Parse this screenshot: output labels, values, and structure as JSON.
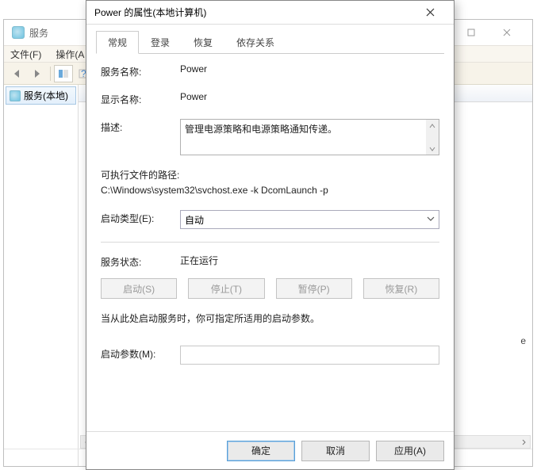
{
  "bgwin": {
    "title": "服务",
    "menu": {
      "file": "文件(F)",
      "action": "操作(A"
    },
    "tree_item": "服务(本地)",
    "extra_letter": "e"
  },
  "dialog": {
    "title": "Power 的属性(本地计算机)",
    "tabs": {
      "general": "常规",
      "logon": "登录",
      "recovery": "恢复",
      "deps": "依存关系"
    },
    "labels": {
      "service_name": "服务名称:",
      "display_name": "显示名称:",
      "description": "描述:",
      "exe_path": "可执行文件的路径:",
      "startup_type": "启动类型(E):",
      "service_state": "服务状态:",
      "start_params_hint": "当从此处启动服务时，你可指定所适用的启动参数。",
      "start_params": "启动参数(M):"
    },
    "values": {
      "service_name": "Power",
      "display_name": "Power",
      "description": "管理电源策略和电源策略通知传递。",
      "exe_path": "C:\\Windows\\system32\\svchost.exe -k DcomLaunch -p",
      "startup_type": "自动",
      "service_state": "正在运行"
    },
    "buttons": {
      "start": "启动(S)",
      "stop": "停止(T)",
      "pause": "暂停(P)",
      "resume": "恢复(R)",
      "ok": "确定",
      "cancel": "取消",
      "apply": "应用(A)"
    }
  }
}
